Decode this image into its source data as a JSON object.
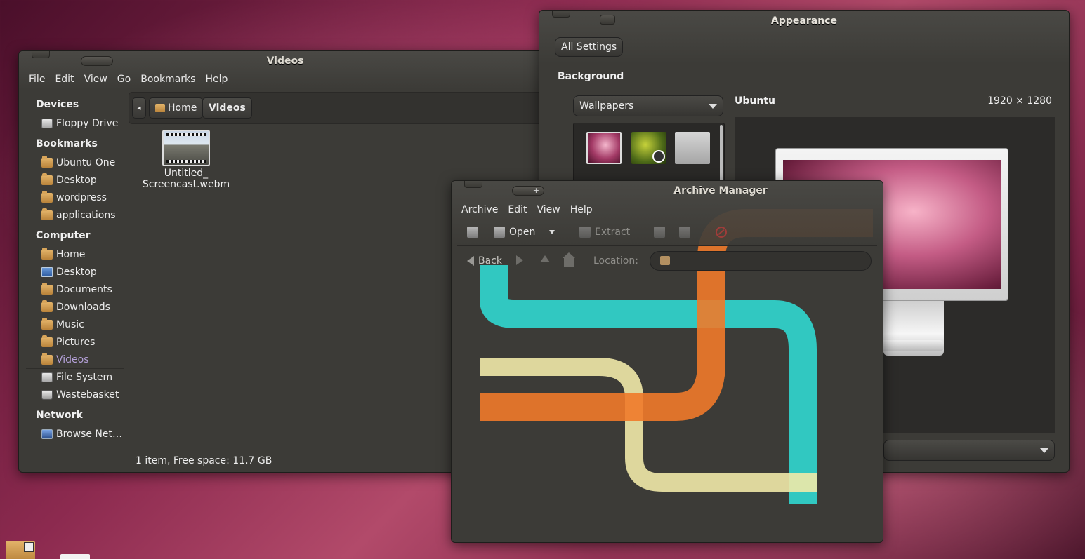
{
  "files_window": {
    "title": "Videos",
    "menu": [
      "File",
      "Edit",
      "View",
      "Go",
      "Bookmarks",
      "Help"
    ],
    "sidebar": {
      "devices_header": "Devices",
      "devices": [
        "Floppy Drive"
      ],
      "bookmarks_header": "Bookmarks",
      "bookmarks": [
        "Ubuntu One",
        "Desktop",
        "wordpress",
        "applications"
      ],
      "computer_header": "Computer",
      "computer": [
        "Home",
        "Desktop",
        "Documents",
        "Downloads",
        "Music",
        "Pictures",
        "Videos",
        "File System",
        "Wastebasket"
      ],
      "network_header": "Network",
      "network": [
        "Browse Net…"
      ]
    },
    "path": {
      "back": "◂",
      "home": "Home",
      "current": "Videos"
    },
    "file": {
      "name_line1": "Untitled_",
      "name_line2": "Screencast.webm"
    },
    "status": "1 item, Free space: 11.7 GB"
  },
  "appearance_window": {
    "title": "Appearance",
    "all_settings": "All Settings",
    "background_label": "Background",
    "wallpapers_combo": "Wallpapers",
    "selected_name": "Ubuntu",
    "selected_size": "1920 × 1280"
  },
  "archive_window": {
    "title": "Archive Manager",
    "menu": [
      "Archive",
      "Edit",
      "View",
      "Help"
    ],
    "toolbar": {
      "open": "Open",
      "extract": "Extract"
    },
    "nav": {
      "back": "Back",
      "location_label": "Location:"
    }
  },
  "colors": {
    "window_bg": "#3c3b37",
    "selected_sidebar": "#b4a0d8",
    "accent_orange": "#f07a2a",
    "accent_cyan": "#2fe0d8"
  }
}
